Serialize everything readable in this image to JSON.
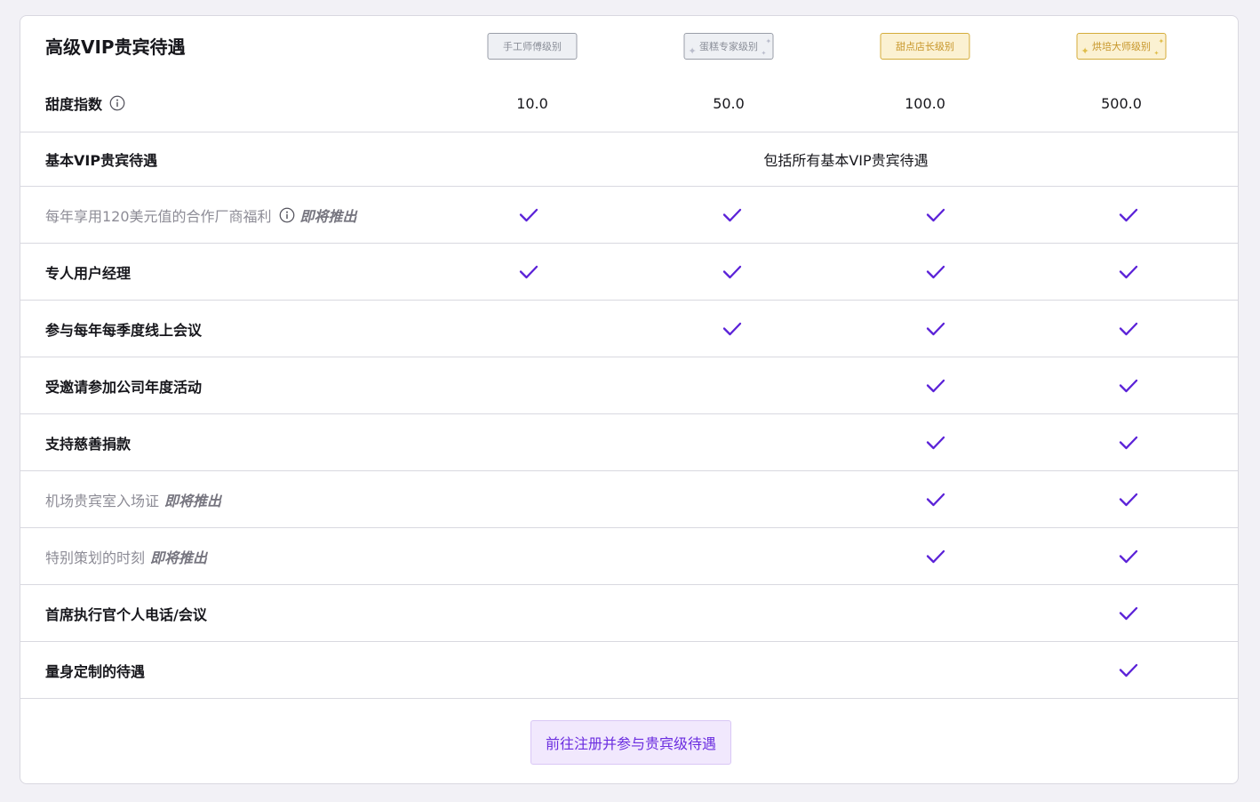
{
  "title": "高级VIP贵宾待遇",
  "tiers": [
    {
      "label": "手工师傅级别",
      "style": "silver",
      "sparkles": false
    },
    {
      "label": "蛋糕专家级别",
      "style": "silver",
      "sparkles": true
    },
    {
      "label": "甜点店长级别",
      "style": "gold",
      "sparkles": false
    },
    {
      "label": "烘培大师级别",
      "style": "gold",
      "sparkles": true
    }
  ],
  "sweetness": {
    "label": "甜度指数",
    "icon": "info-icon",
    "values": [
      "10.0",
      "50.0",
      "100.0",
      "500.0"
    ]
  },
  "basic_row": {
    "label": "基本VIP贵宾待遇",
    "value": "包括所有基本VIP贵宾待遇"
  },
  "coming_soon_label": "即将推出",
  "benefits": [
    {
      "label": "每年享用120美元值的合作厂商福利",
      "info": true,
      "coming_soon": true,
      "checks": [
        true,
        true,
        true,
        true
      ]
    },
    {
      "label": "专人用户经理",
      "info": false,
      "coming_soon": false,
      "checks": [
        true,
        true,
        true,
        true
      ]
    },
    {
      "label": "参与每年每季度线上会议",
      "info": false,
      "coming_soon": false,
      "checks": [
        false,
        true,
        true,
        true
      ]
    },
    {
      "label": "受邀请参加公司年度活动",
      "info": false,
      "coming_soon": false,
      "checks": [
        false,
        false,
        true,
        true
      ]
    },
    {
      "label": "支持慈善捐款",
      "info": false,
      "coming_soon": false,
      "checks": [
        false,
        false,
        true,
        true
      ]
    },
    {
      "label": "机场贵宾室入场证",
      "info": false,
      "coming_soon": true,
      "checks": [
        false,
        false,
        true,
        true
      ]
    },
    {
      "label": "特别策划的时刻",
      "info": false,
      "coming_soon": true,
      "checks": [
        false,
        false,
        true,
        true
      ]
    },
    {
      "label": "首席执行官个人电话/会议",
      "info": false,
      "coming_soon": false,
      "checks": [
        false,
        false,
        false,
        true
      ]
    },
    {
      "label": "量身定制的待遇",
      "info": false,
      "coming_soon": false,
      "checks": [
        false,
        false,
        false,
        true
      ]
    }
  ],
  "cta": {
    "label": "前往注册并参与贵宾级待遇"
  },
  "colors": {
    "accent": "#6b2de0",
    "check": "#5b22d8",
    "silver_badge": "#9a9ea8",
    "gold_badge": "#d4ac3a"
  }
}
